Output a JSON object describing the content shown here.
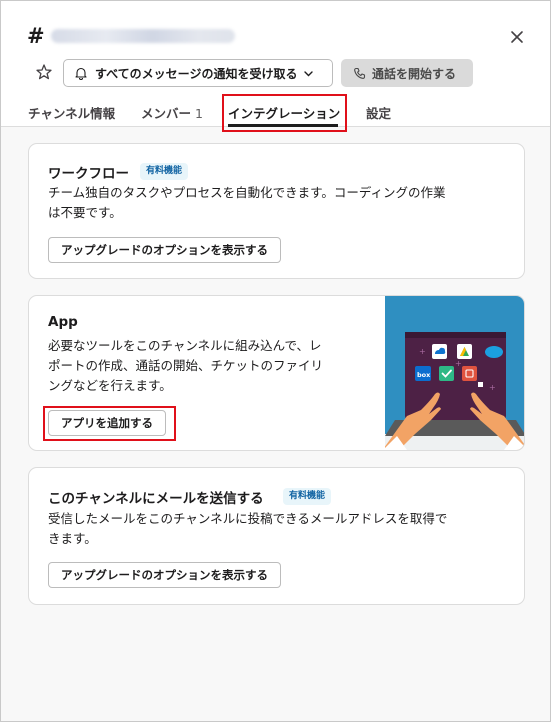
{
  "header": {
    "hash": "#",
    "channel_name": "",
    "notify_label": "すべてのメッセージの通知を受け取る",
    "call_label": "通話を開始する"
  },
  "tabs": [
    {
      "label": "チャンネル情報",
      "count": ""
    },
    {
      "label": "メンバー",
      "count": "1"
    },
    {
      "label": "インテグレーション",
      "count": "",
      "active": true
    },
    {
      "label": "設定",
      "count": ""
    }
  ],
  "workflow": {
    "title": "ワークフロー",
    "badge": "有料機能",
    "desc_lines": [
      "チーム独自のタスクやプロセスを自動化できます。コーディングの作業",
      "は不要です。"
    ],
    "button": "アップグレードのオプションを表示する"
  },
  "app": {
    "title": "App",
    "desc_lines": [
      "必要なツールをこのチャンネルに組み込んで、レ",
      "ポートの作成、通話の開始、チケットのファイリ",
      "ングなどを行えます。"
    ],
    "button": "アプリを追加する",
    "illustration": {
      "box_label": "box"
    }
  },
  "email": {
    "title": "このチャンネルにメールを送信する",
    "badge": "有料機能",
    "desc_lines": [
      "受信したメールをこのチャンネルに投稿できるメールアドレスを取得で",
      "きます。"
    ],
    "button": "アップグレードのオプションを表示する"
  },
  "icons": {
    "close": "close-icon",
    "star": "star-icon",
    "bell": "bell-icon",
    "chevron": "chevron-down-icon",
    "phone": "phone-icon"
  },
  "colors": {
    "highlight": "#e0101a",
    "badge_text": "#1264a3",
    "badge_bg": "#e8f5fa",
    "illus_bg": "#2f8fc1",
    "laptop": "#4d2145"
  }
}
